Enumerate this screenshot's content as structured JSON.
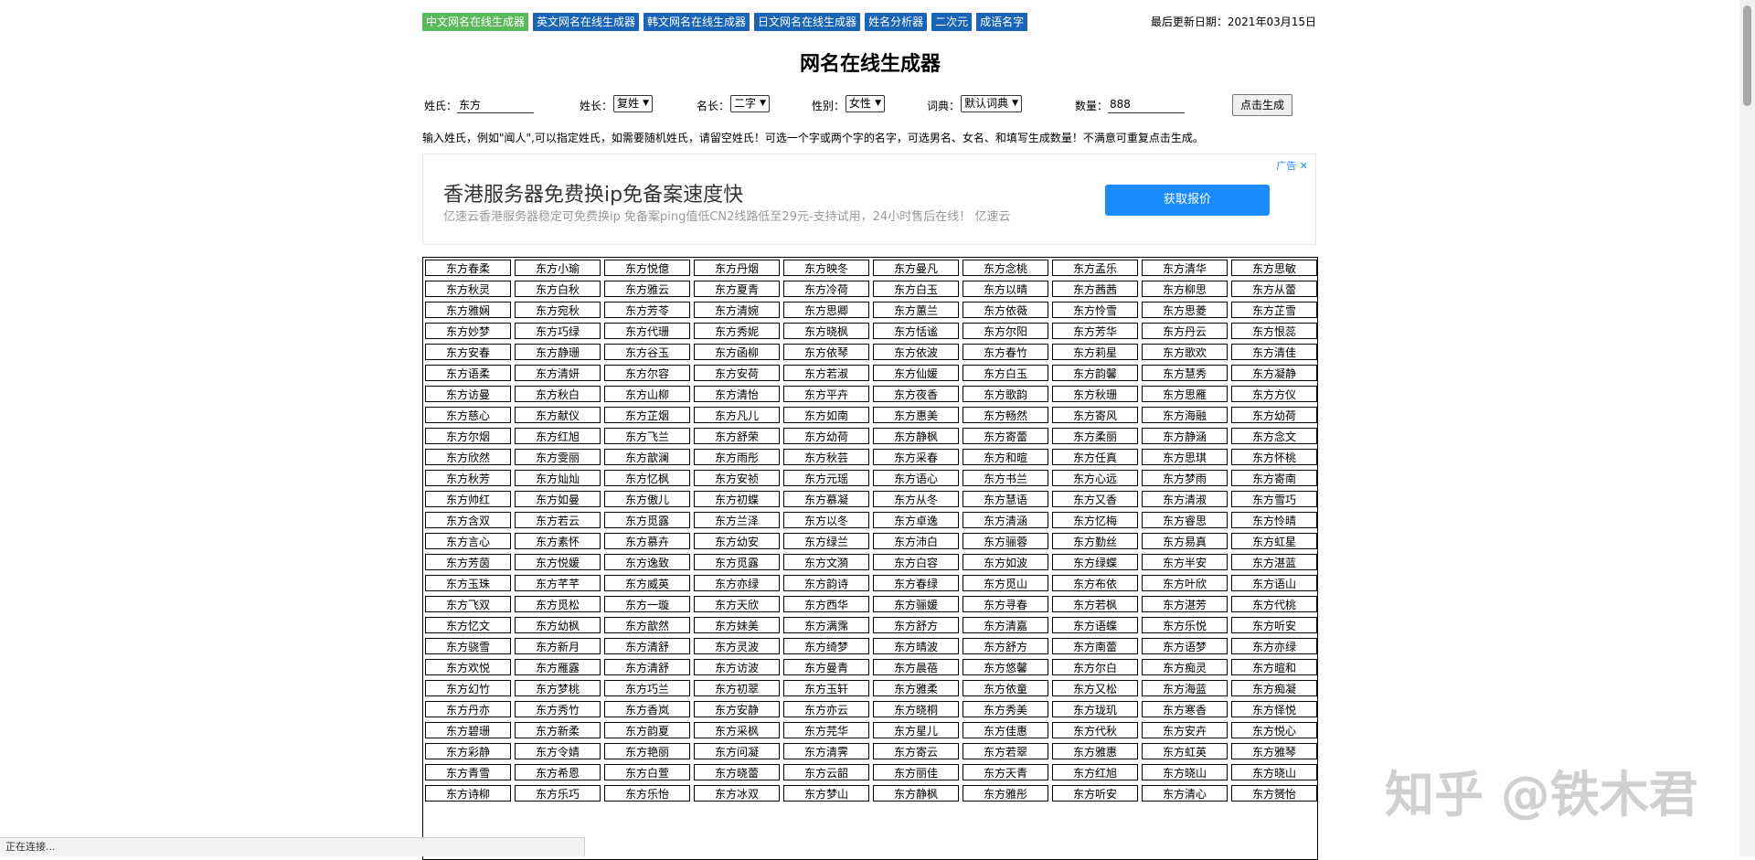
{
  "nav": {
    "items": [
      "中文网名在线生成器",
      "英文网名在线生成器",
      "韩文网名在线生成器",
      "日文网名在线生成器",
      "姓名分析器",
      "二次元",
      "成语名字"
    ],
    "updated": "最后更新日期：2021年03月15日"
  },
  "title": "网名在线生成器",
  "form": {
    "surname_label": "姓氏：",
    "surname_value": "东方",
    "surname_len_label": "姓长：",
    "surname_len_value": "复姓",
    "name_len_label": "名长：",
    "name_len_value": "二字",
    "gender_label": "性别：",
    "gender_value": "女性",
    "dict_label": "词典：",
    "dict_value": "默认词典",
    "count_label": "数量：",
    "count_value": "888",
    "generate_label": "点击生成"
  },
  "hint": "输入姓氏，例如\"闻人\",可以指定姓氏，如需要随机姓氏，请留空姓氏！可选一个字或两个字的名字，可选男名、女名、和填写生成数量！不满意可重复点击生成。",
  "ad": {
    "headline": "香港服务器免费换ip免备案速度快",
    "subtitle": "亿速云香港服务器稳定可免费换ip 免备案ping值低CN2线路低至29元-支持试用，24小时售后在线！ 亿速云",
    "button": "获取报价",
    "label": "广告 ✕"
  },
  "names": [
    "东方春柔",
    "东方小瑜",
    "东方悦億",
    "东方丹烟",
    "东方映冬",
    "东方曼凡",
    "东方念桃",
    "东方孟乐",
    "东方清华",
    "东方思敏",
    "东方秋灵",
    "东方白秋",
    "东方雅云",
    "东方夏青",
    "东方冷荷",
    "东方白玉",
    "东方以晴",
    "东方茜茜",
    "东方柳思",
    "东方从蕾",
    "东方雅娴",
    "东方宛秋",
    "东方芳苓",
    "东方清婉",
    "东方思卿",
    "东方蕙兰",
    "东方依薇",
    "东方怜雪",
    "东方思菱",
    "东方芷雪",
    "东方妙梦",
    "东方巧绿",
    "东方代珊",
    "东方秀妮",
    "东方晓枫",
    "东方恬谧",
    "东方尔阳",
    "东方芳华",
    "东方丹云",
    "东方恨蕊",
    "东方安春",
    "东方静珊",
    "东方谷玉",
    "东方函柳",
    "东方依琴",
    "东方依波",
    "东方春竹",
    "东方莉星",
    "东方歌欢",
    "东方清佳",
    "东方语柔",
    "东方清妍",
    "东方尔容",
    "东方安荷",
    "东方若淑",
    "东方仙媛",
    "东方白玉",
    "东方韵馨",
    "东方慧秀",
    "东方凝静",
    "东方访曼",
    "东方秋白",
    "东方山柳",
    "东方清怡",
    "东方平卉",
    "东方夜香",
    "东方歌韵",
    "东方秋珊",
    "东方思雁",
    "东方方仪",
    "东方慈心",
    "东方献仪",
    "东方芷烟",
    "东方凡儿",
    "东方如南",
    "东方惠美",
    "东方畅然",
    "东方寄风",
    "东方海融",
    "东方幼荷",
    "东方尔烟",
    "东方红旭",
    "东方飞兰",
    "东方舒荣",
    "东方幼荷",
    "东方静枫",
    "东方寄蕾",
    "东方柔丽",
    "东方静涵",
    "东方念文",
    "东方欣然",
    "东方雯丽",
    "东方歆澜",
    "东方雨彤",
    "东方秋芸",
    "东方采春",
    "东方和暄",
    "东方任真",
    "东方思琪",
    "东方怀桃",
    "东方秋芳",
    "东方灿灿",
    "东方忆枫",
    "东方安祯",
    "东方元瑶",
    "东方语心",
    "东方书兰",
    "东方心远",
    "东方梦雨",
    "东方寄南",
    "东方帅红",
    "东方如曼",
    "东方傲儿",
    "东方初蝶",
    "东方慕凝",
    "东方从冬",
    "东方慧语",
    "东方又香",
    "东方清淑",
    "东方雪巧",
    "东方含双",
    "东方若云",
    "东方觅露",
    "东方兰泽",
    "东方以冬",
    "东方卓逸",
    "东方清涵",
    "东方忆梅",
    "东方睿思",
    "东方怜晴",
    "东方言心",
    "东方素怀",
    "东方慕卉",
    "东方幼安",
    "东方绿兰",
    "东方沛白",
    "东方骊蓉",
    "东方勤丝",
    "东方易真",
    "东方虹星",
    "东方芳茵",
    "东方悦媛",
    "东方逸致",
    "东方觅露",
    "东方文漪",
    "东方白容",
    "东方如波",
    "东方绿蝶",
    "东方半安",
    "东方湛蓝",
    "东方玉珠",
    "东方芊芊",
    "东方威英",
    "东方亦绿",
    "东方韵诗",
    "东方春绿",
    "东方觅山",
    "东方布依",
    "东方叶欣",
    "东方语山",
    "东方飞双",
    "东方觅松",
    "东方一璇",
    "东方天欣",
    "东方西华",
    "东方骊媛",
    "东方寻春",
    "东方若枫",
    "东方湛芳",
    "东方代桃",
    "东方忆文",
    "东方幼枫",
    "东方歆然",
    "东方妹美",
    "东方满霈",
    "东方舒方",
    "东方清嘉",
    "东方语蝶",
    "东方乐悦",
    "东方听安",
    "东方骁雪",
    "东方新月",
    "东方清舒",
    "东方灵波",
    "东方绮梦",
    "东方晴波",
    "东方舒方",
    "东方南蕾",
    "东方语梦",
    "东方亦绿",
    "东方欢悦",
    "东方雁露",
    "东方清舒",
    "东方访波",
    "东方曼青",
    "东方晨蓓",
    "东方悠馨",
    "东方尔白",
    "东方痴灵",
    "东方暄和",
    "东方幻竹",
    "东方梦桃",
    "东方巧兰",
    "东方初翠",
    "东方玉轩",
    "东方雅柔",
    "东方依童",
    "东方又松",
    "东方海蓝",
    "东方痴凝",
    "东方丹亦",
    "东方秀竹",
    "东方香岚",
    "东方安静",
    "东方亦云",
    "东方晓桐",
    "东方秀美",
    "东方珑玑",
    "东方寒香",
    "东方怿悦",
    "东方碧珊",
    "东方新柔",
    "东方韵夏",
    "东方采枫",
    "东方芫华",
    "东方星儿",
    "东方佳惠",
    "东方代秋",
    "东方安卉",
    "东方悦心",
    "东方彩静",
    "东方令婧",
    "东方艳丽",
    "东方问凝",
    "东方清霁",
    "东方寄云",
    "东方若翠",
    "东方雅惠",
    "东方虹英",
    "东方雅琴",
    "东方青雪",
    "东方希恩",
    "东方白萱",
    "东方晓蕾",
    "东方云韶",
    "东方丽佳",
    "东方天青",
    "东方红旭",
    "东方晓山",
    "东方晓山",
    "东方诗柳",
    "东方乐巧",
    "东方乐怡",
    "东方冰双",
    "东方梦山",
    "东方静枫",
    "东方雅彤",
    "东方听安",
    "东方清心",
    "东方赟怡"
  ],
  "statusbar": "正在连接...",
  "watermark": "知乎 @铁木君"
}
